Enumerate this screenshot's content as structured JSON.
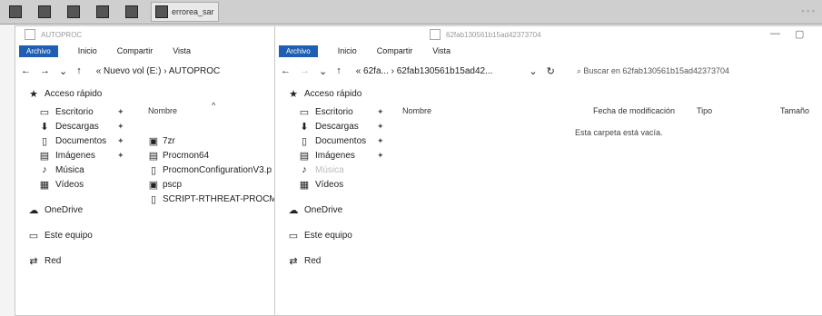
{
  "taskbar": {
    "tasks": [
      {
        "label": "",
        "active": false
      },
      {
        "label": "",
        "active": false
      },
      {
        "label": "",
        "active": false
      },
      {
        "label": "",
        "active": false
      },
      {
        "label": "",
        "active": false
      },
      {
        "label": "errorea_sar",
        "active": true
      }
    ]
  },
  "left_window": {
    "title": "AUTOPROC",
    "ribbon": {
      "file": "Archivo",
      "tabs": [
        "Inicio",
        "Compartir",
        "Vista"
      ]
    },
    "breadcrumb": "« Nuevo vol (E:)  ›  AUTOPROC",
    "column_header": "Nombre",
    "files": [
      {
        "icon": "app-icon",
        "name": "7zr"
      },
      {
        "icon": "app-icon",
        "name": "Procmon64"
      },
      {
        "icon": "document-icon",
        "name": "ProcmonConfigurationV3.p"
      },
      {
        "icon": "app-icon",
        "name": "pscp"
      },
      {
        "icon": "document-icon",
        "name": "SCRIPT-RTHREAT-PROCMO"
      }
    ]
  },
  "right_window": {
    "title": "62fab130561b15ad42373704",
    "ribbon": {
      "file": "Archivo",
      "tabs": [
        "Inicio",
        "Compartir",
        "Vista"
      ]
    },
    "breadcrumb": "« 62fa...  ›  62fab130561b15ad42...",
    "search_placeholder": "Buscar en 62fab130561b15ad42373704",
    "columns": [
      "Nombre",
      "Fecha de modificación",
      "Tipo",
      "Tamaño"
    ],
    "empty_message": "Esta carpeta está vacía."
  },
  "nav": {
    "quick_access": "Acceso rápido",
    "items": [
      {
        "label": "Escritorio",
        "icon": "desktop-icon",
        "pinned": true
      },
      {
        "label": "Descargas",
        "icon": "download-icon",
        "pinned": true
      },
      {
        "label": "Documentos",
        "icon": "document-icon",
        "pinned": true
      },
      {
        "label": "Imágenes",
        "icon": "images-icon",
        "pinned": true
      },
      {
        "label": "Música",
        "icon": "music-icon",
        "pinned": false
      },
      {
        "label": "Vídeos",
        "icon": "video-icon",
        "pinned": false
      }
    ],
    "onedrive": "OneDrive",
    "this_pc": "Este equipo",
    "network": "Red"
  }
}
